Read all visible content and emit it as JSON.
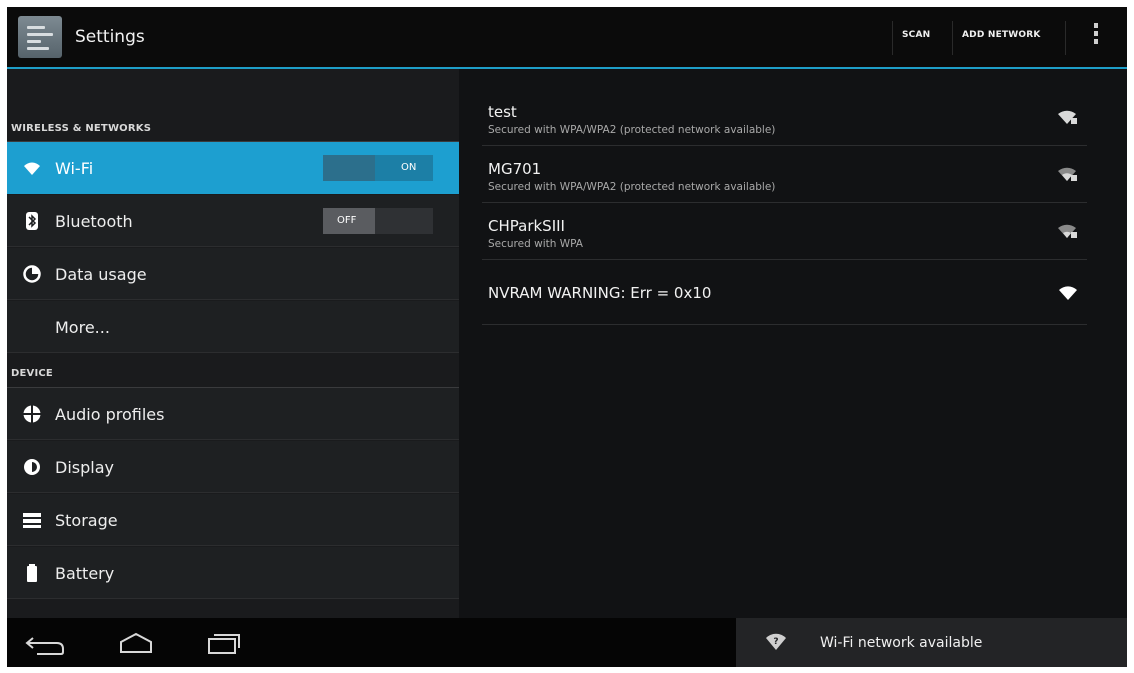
{
  "action_bar": {
    "title": "Settings",
    "scan_label": "SCAN",
    "add_network_label": "ADD NETWORK",
    "accent_color": "#1e9ec8"
  },
  "sidebar": {
    "section_wireless": "WIRELESS & NETWORKS",
    "section_device": "DEVICE",
    "items": [
      {
        "label": "Wi-Fi",
        "icon": "wifi-icon",
        "toggle": "ON",
        "selected": true
      },
      {
        "label": "Bluetooth",
        "icon": "bluetooth-icon",
        "toggle": "OFF"
      },
      {
        "label": "Data usage",
        "icon": "data-usage-icon"
      },
      {
        "label": "More..."
      },
      {
        "label": "Audio profiles",
        "icon": "audio-profiles-icon"
      },
      {
        "label": "Display",
        "icon": "display-icon"
      },
      {
        "label": "Storage",
        "icon": "storage-icon"
      },
      {
        "label": "Battery",
        "icon": "battery-icon"
      }
    ]
  },
  "networks": [
    {
      "ssid": "test",
      "summary": "Secured with WPA/WPA2 (protected network available)",
      "icon": "wifi-signal-locked-icon"
    },
    {
      "ssid": "MG701",
      "summary": "Secured with WPA/WPA2 (protected network available)",
      "icon": "wifi-signal-locked-icon"
    },
    {
      "ssid": "CHParkSIII",
      "summary": "Secured with WPA",
      "icon": "wifi-signal-locked-icon"
    },
    {
      "ssid": "NVRAM WARNING: Err = 0x10",
      "summary": "",
      "icon": "wifi-signal-icon"
    }
  ],
  "navigation": {
    "back": "back-icon",
    "home": "home-icon",
    "recents": "recent-apps-icon"
  },
  "notification": {
    "text": "Wi-Fi network available",
    "icon": "wifi-question-icon"
  }
}
